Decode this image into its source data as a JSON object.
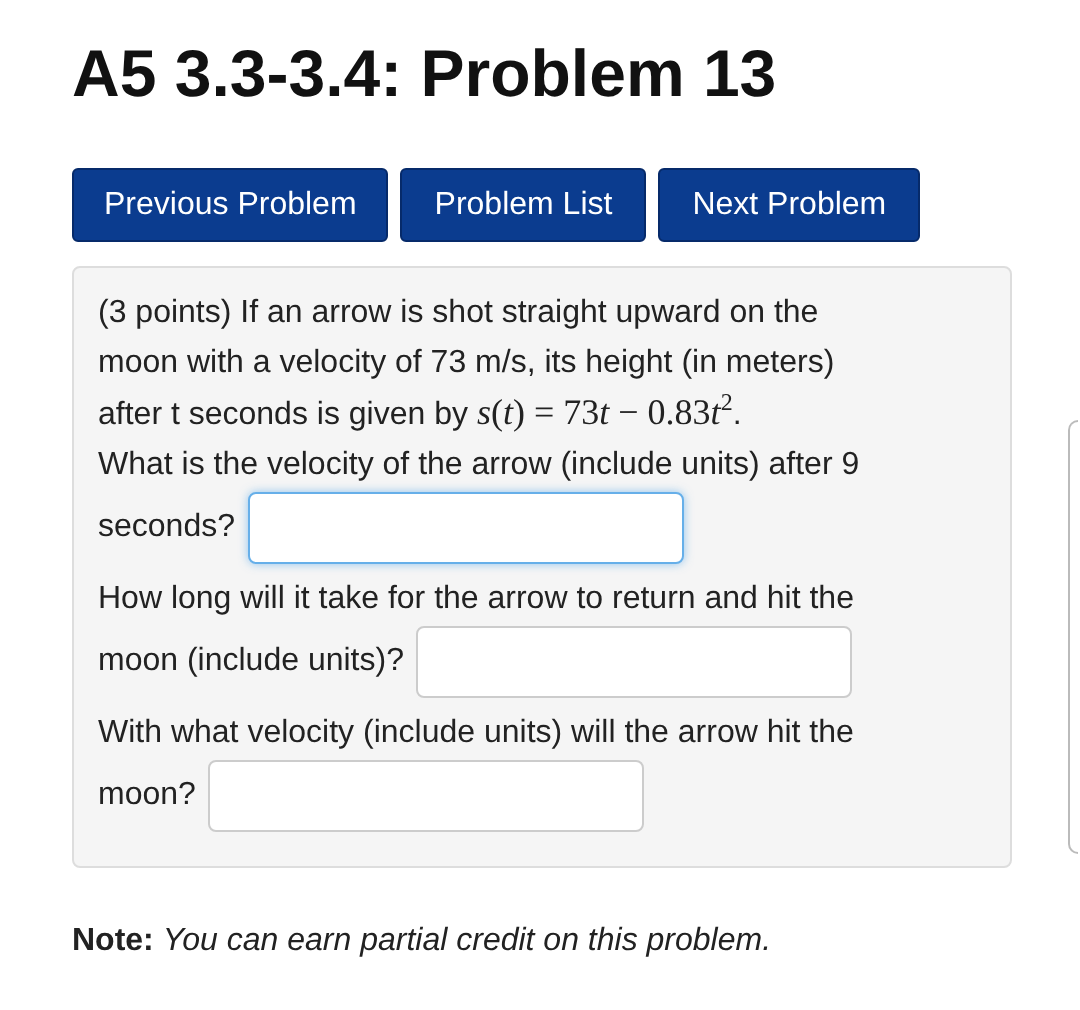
{
  "title": "A5 3.3-3.4: Problem 13",
  "nav_buttons": [
    "Previous Problem",
    "Problem List",
    "Next Problem"
  ],
  "problem": {
    "intro_lines": [
      "(3 points) If an arrow is shot straight upward on the",
      "moon with a velocity of 73 m/s, its height (in meters)",
      "after t seconds is given by"
    ],
    "formula": [
      {
        "kind": "var",
        "text": "s"
      },
      {
        "kind": "num",
        "text": "("
      },
      {
        "kind": "var",
        "text": "t"
      },
      {
        "kind": "num",
        "text": ") = 73"
      },
      {
        "kind": "var",
        "text": "t"
      },
      {
        "kind": "num",
        "text": " − 0.83"
      },
      {
        "kind": "var",
        "text": "t"
      },
      {
        "kind": "sup",
        "text": "2"
      }
    ],
    "intro_end": ".",
    "questions": [
      {
        "lines": [
          "What is the velocity of the arrow (include units) after 9",
          "seconds?"
        ],
        "focused": true
      },
      {
        "lines": [
          "How long will it take for the arrow to return and hit the",
          "moon (include units)?"
        ],
        "focused": false
      },
      {
        "lines": [
          "With what velocity (include units) will the arrow hit the",
          "moon?"
        ],
        "focused": false
      }
    ]
  },
  "note": {
    "label": "Note:",
    "text": "You can earn partial credit on this problem."
  }
}
